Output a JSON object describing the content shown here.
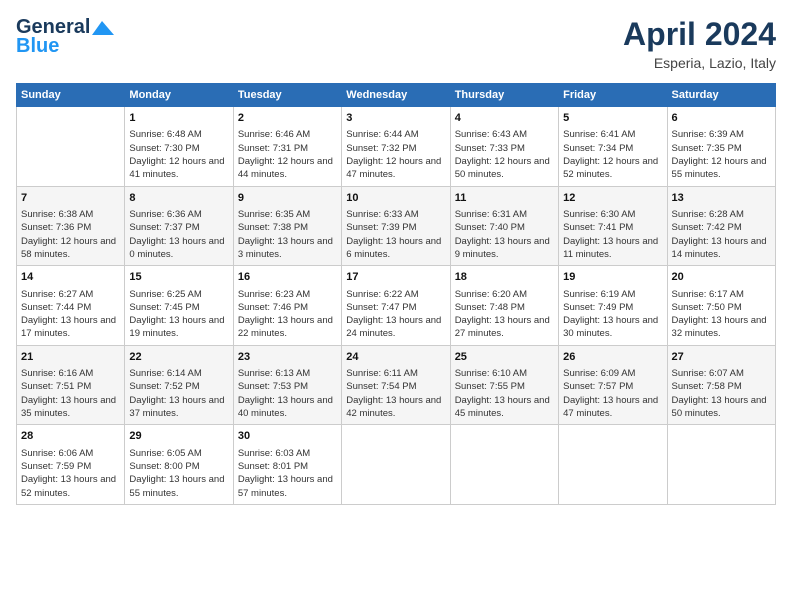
{
  "header": {
    "logo_line1": "General",
    "logo_line2": "Blue",
    "month": "April 2024",
    "location": "Esperia, Lazio, Italy"
  },
  "columns": [
    "Sunday",
    "Monday",
    "Tuesday",
    "Wednesday",
    "Thursday",
    "Friday",
    "Saturday"
  ],
  "weeks": [
    [
      {
        "day": "",
        "sunrise": "",
        "sunset": "",
        "daylight": ""
      },
      {
        "day": "1",
        "sunrise": "Sunrise: 6:48 AM",
        "sunset": "Sunset: 7:30 PM",
        "daylight": "Daylight: 12 hours and 41 minutes."
      },
      {
        "day": "2",
        "sunrise": "Sunrise: 6:46 AM",
        "sunset": "Sunset: 7:31 PM",
        "daylight": "Daylight: 12 hours and 44 minutes."
      },
      {
        "day": "3",
        "sunrise": "Sunrise: 6:44 AM",
        "sunset": "Sunset: 7:32 PM",
        "daylight": "Daylight: 12 hours and 47 minutes."
      },
      {
        "day": "4",
        "sunrise": "Sunrise: 6:43 AM",
        "sunset": "Sunset: 7:33 PM",
        "daylight": "Daylight: 12 hours and 50 minutes."
      },
      {
        "day": "5",
        "sunrise": "Sunrise: 6:41 AM",
        "sunset": "Sunset: 7:34 PM",
        "daylight": "Daylight: 12 hours and 52 minutes."
      },
      {
        "day": "6",
        "sunrise": "Sunrise: 6:39 AM",
        "sunset": "Sunset: 7:35 PM",
        "daylight": "Daylight: 12 hours and 55 minutes."
      }
    ],
    [
      {
        "day": "7",
        "sunrise": "Sunrise: 6:38 AM",
        "sunset": "Sunset: 7:36 PM",
        "daylight": "Daylight: 12 hours and 58 minutes."
      },
      {
        "day": "8",
        "sunrise": "Sunrise: 6:36 AM",
        "sunset": "Sunset: 7:37 PM",
        "daylight": "Daylight: 13 hours and 0 minutes."
      },
      {
        "day": "9",
        "sunrise": "Sunrise: 6:35 AM",
        "sunset": "Sunset: 7:38 PM",
        "daylight": "Daylight: 13 hours and 3 minutes."
      },
      {
        "day": "10",
        "sunrise": "Sunrise: 6:33 AM",
        "sunset": "Sunset: 7:39 PM",
        "daylight": "Daylight: 13 hours and 6 minutes."
      },
      {
        "day": "11",
        "sunrise": "Sunrise: 6:31 AM",
        "sunset": "Sunset: 7:40 PM",
        "daylight": "Daylight: 13 hours and 9 minutes."
      },
      {
        "day": "12",
        "sunrise": "Sunrise: 6:30 AM",
        "sunset": "Sunset: 7:41 PM",
        "daylight": "Daylight: 13 hours and 11 minutes."
      },
      {
        "day": "13",
        "sunrise": "Sunrise: 6:28 AM",
        "sunset": "Sunset: 7:42 PM",
        "daylight": "Daylight: 13 hours and 14 minutes."
      }
    ],
    [
      {
        "day": "14",
        "sunrise": "Sunrise: 6:27 AM",
        "sunset": "Sunset: 7:44 PM",
        "daylight": "Daylight: 13 hours and 17 minutes."
      },
      {
        "day": "15",
        "sunrise": "Sunrise: 6:25 AM",
        "sunset": "Sunset: 7:45 PM",
        "daylight": "Daylight: 13 hours and 19 minutes."
      },
      {
        "day": "16",
        "sunrise": "Sunrise: 6:23 AM",
        "sunset": "Sunset: 7:46 PM",
        "daylight": "Daylight: 13 hours and 22 minutes."
      },
      {
        "day": "17",
        "sunrise": "Sunrise: 6:22 AM",
        "sunset": "Sunset: 7:47 PM",
        "daylight": "Daylight: 13 hours and 24 minutes."
      },
      {
        "day": "18",
        "sunrise": "Sunrise: 6:20 AM",
        "sunset": "Sunset: 7:48 PM",
        "daylight": "Daylight: 13 hours and 27 minutes."
      },
      {
        "day": "19",
        "sunrise": "Sunrise: 6:19 AM",
        "sunset": "Sunset: 7:49 PM",
        "daylight": "Daylight: 13 hours and 30 minutes."
      },
      {
        "day": "20",
        "sunrise": "Sunrise: 6:17 AM",
        "sunset": "Sunset: 7:50 PM",
        "daylight": "Daylight: 13 hours and 32 minutes."
      }
    ],
    [
      {
        "day": "21",
        "sunrise": "Sunrise: 6:16 AM",
        "sunset": "Sunset: 7:51 PM",
        "daylight": "Daylight: 13 hours and 35 minutes."
      },
      {
        "day": "22",
        "sunrise": "Sunrise: 6:14 AM",
        "sunset": "Sunset: 7:52 PM",
        "daylight": "Daylight: 13 hours and 37 minutes."
      },
      {
        "day": "23",
        "sunrise": "Sunrise: 6:13 AM",
        "sunset": "Sunset: 7:53 PM",
        "daylight": "Daylight: 13 hours and 40 minutes."
      },
      {
        "day": "24",
        "sunrise": "Sunrise: 6:11 AM",
        "sunset": "Sunset: 7:54 PM",
        "daylight": "Daylight: 13 hours and 42 minutes."
      },
      {
        "day": "25",
        "sunrise": "Sunrise: 6:10 AM",
        "sunset": "Sunset: 7:55 PM",
        "daylight": "Daylight: 13 hours and 45 minutes."
      },
      {
        "day": "26",
        "sunrise": "Sunrise: 6:09 AM",
        "sunset": "Sunset: 7:57 PM",
        "daylight": "Daylight: 13 hours and 47 minutes."
      },
      {
        "day": "27",
        "sunrise": "Sunrise: 6:07 AM",
        "sunset": "Sunset: 7:58 PM",
        "daylight": "Daylight: 13 hours and 50 minutes."
      }
    ],
    [
      {
        "day": "28",
        "sunrise": "Sunrise: 6:06 AM",
        "sunset": "Sunset: 7:59 PM",
        "daylight": "Daylight: 13 hours and 52 minutes."
      },
      {
        "day": "29",
        "sunrise": "Sunrise: 6:05 AM",
        "sunset": "Sunset: 8:00 PM",
        "daylight": "Daylight: 13 hours and 55 minutes."
      },
      {
        "day": "30",
        "sunrise": "Sunrise: 6:03 AM",
        "sunset": "Sunset: 8:01 PM",
        "daylight": "Daylight: 13 hours and 57 minutes."
      },
      {
        "day": "",
        "sunrise": "",
        "sunset": "",
        "daylight": ""
      },
      {
        "day": "",
        "sunrise": "",
        "sunset": "",
        "daylight": ""
      },
      {
        "day": "",
        "sunrise": "",
        "sunset": "",
        "daylight": ""
      },
      {
        "day": "",
        "sunrise": "",
        "sunset": "",
        "daylight": ""
      }
    ]
  ]
}
